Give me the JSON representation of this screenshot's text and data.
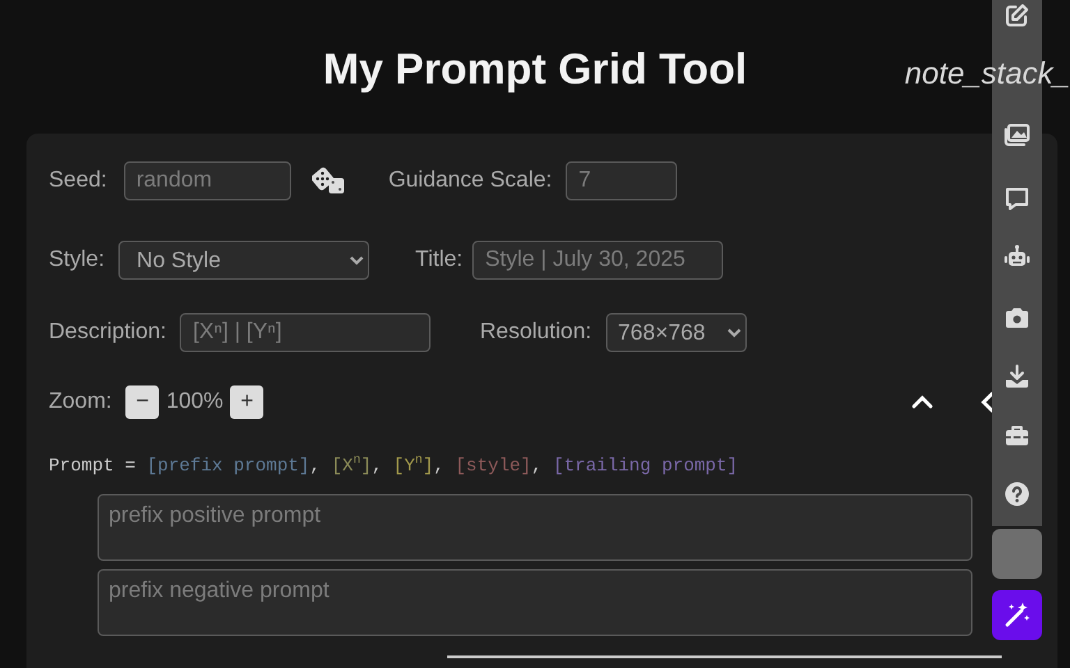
{
  "title": "My Prompt Grid Tool",
  "settings": {
    "seed": {
      "label": "Seed:",
      "placeholder": "random"
    },
    "guidance_scale": {
      "label": "Guidance Scale:",
      "placeholder": "7"
    },
    "style": {
      "label": "Style:",
      "value": "No Style"
    },
    "title": {
      "label": "Title:",
      "placeholder": "Style | July 30, 2025"
    },
    "description": {
      "label": "Description:",
      "placeholder": "[Xⁿ] | [Yⁿ]"
    },
    "resolution": {
      "label": "Resolution:",
      "value": "768×768"
    }
  },
  "zoom": {
    "label": "Zoom:",
    "minus": "−",
    "value": "100%",
    "plus": "+"
  },
  "prompt_formula": {
    "lead": "Prompt =",
    "parts": [
      {
        "text": "[prefix prompt]",
        "suffix": ",",
        "color": "#5e7a96"
      },
      {
        "text": "[X$^{n}$]",
        "suffix": ",",
        "color": "#8c8c58"
      },
      {
        "text": "[Y$^{n}$]",
        "suffix": ",",
        "color": "#a39a4c"
      },
      {
        "text": "[style]",
        "suffix": ",",
        "color": "#8e5a5a"
      },
      {
        "text": "[trailing prompt]",
        "color": "#7a68a8"
      }
    ]
  },
  "prompts": [
    {
      "placeholder": "prefix positive prompt"
    },
    {
      "placeholder": "prefix negative prompt"
    }
  ],
  "sidebar": {
    "label": "note_stack_"
  }
}
